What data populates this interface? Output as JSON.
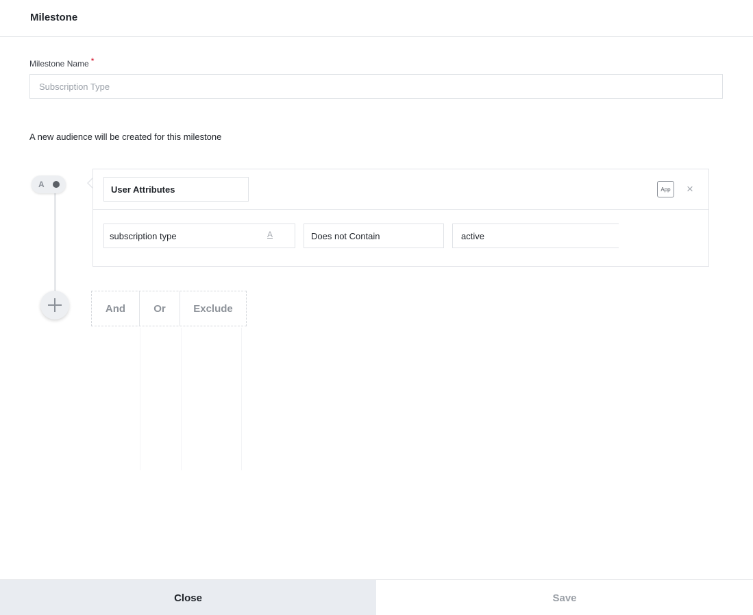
{
  "header": {
    "title": "Milestone"
  },
  "form": {
    "name_label": "Milestone Name",
    "required_mark": "*",
    "name_placeholder": "Subscription Type",
    "name_value": "",
    "audience_note": "A new audience will be created for this milestone"
  },
  "timeline": {
    "node_letter": "A",
    "add_icon": "plus-icon"
  },
  "condition": {
    "type_label": "User Attributes",
    "app_badge": "App",
    "remove_icon": "×",
    "attribute": "subscription type",
    "attribute_type_icon": "A",
    "operator": "Does not Contain",
    "value": "active"
  },
  "combinators": {
    "and": "And",
    "or": "Or",
    "exclude": "Exclude"
  },
  "footer": {
    "close_label": "Close",
    "save_label": "Save"
  },
  "colors": {
    "close_bg": "#e9ecf1",
    "required": "#d0021b",
    "muted_text": "#8e939a"
  }
}
